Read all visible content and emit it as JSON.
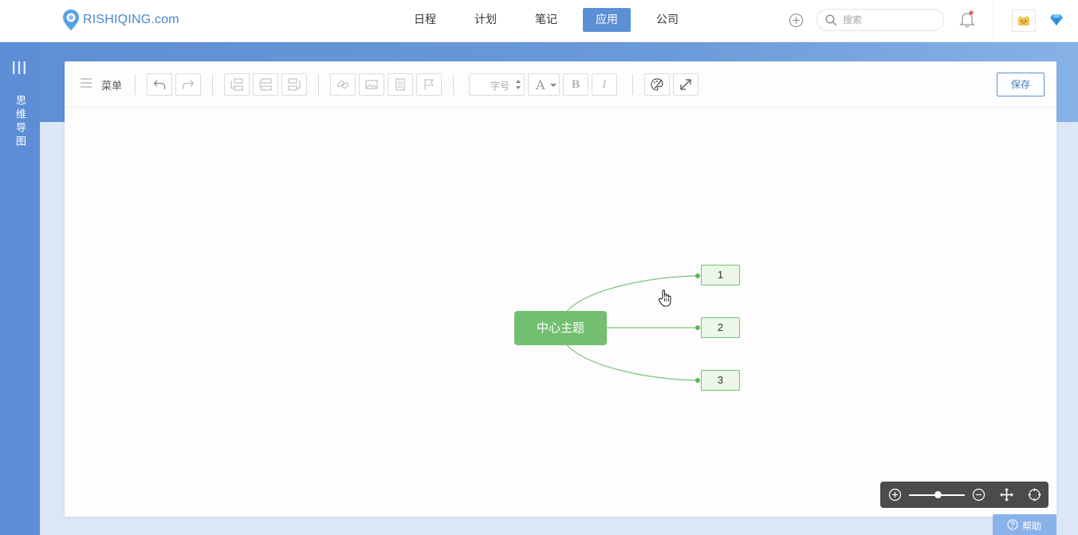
{
  "brand": {
    "logo_text": "RISHIQING.com"
  },
  "nav": {
    "items": [
      {
        "label": "日程",
        "active": false
      },
      {
        "label": "计划",
        "active": false
      },
      {
        "label": "笔记",
        "active": false
      },
      {
        "label": "应用",
        "active": true
      },
      {
        "label": "公司",
        "active": false
      }
    ]
  },
  "search": {
    "placeholder": "搜索"
  },
  "sidebar": {
    "label": "思维导图"
  },
  "toolbar": {
    "menu_label": "菜单",
    "font_size_placeholder": "字号",
    "bold_label": "B",
    "italic_label": "I",
    "font_color_label": "A",
    "save_label": "保存"
  },
  "mindmap": {
    "central_topic": "中心主题",
    "children": [
      "1",
      "2",
      "3"
    ],
    "node_color": "#72bf6f",
    "line_color": "#7cc279"
  },
  "help": {
    "label": "帮助"
  },
  "colors": {
    "accent": "#5b8fd6",
    "sidebar": "#5d8ed5",
    "zoom_panel": "#4b4b4b"
  }
}
